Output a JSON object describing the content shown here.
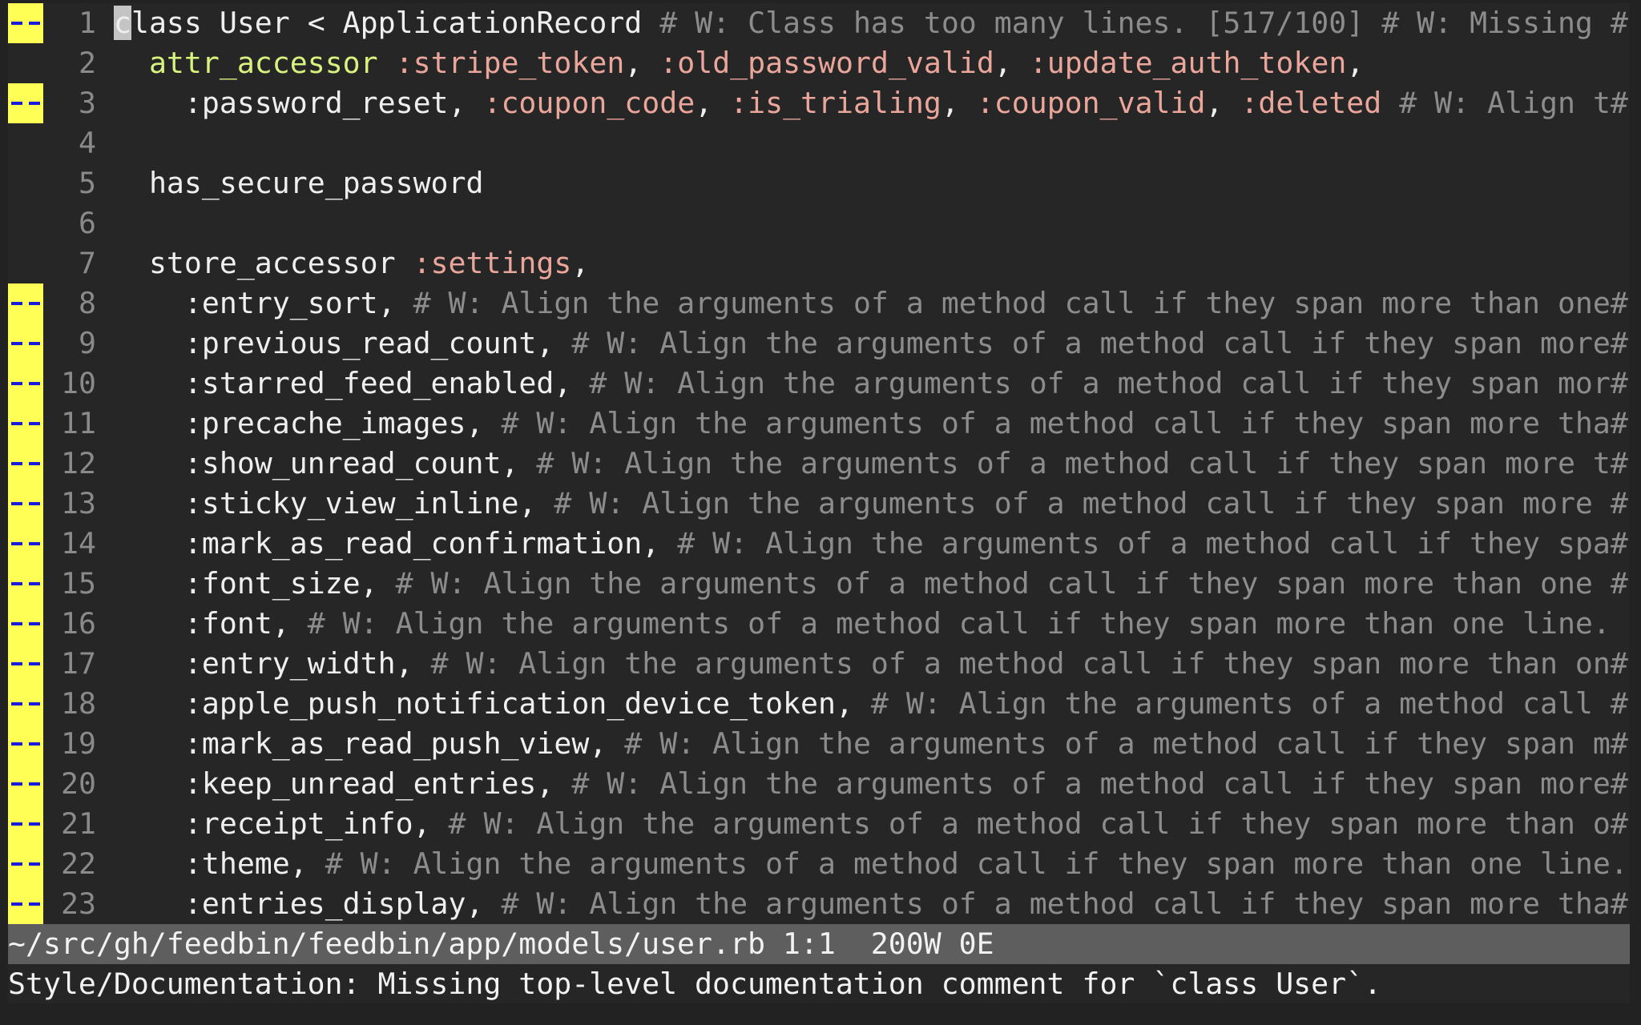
{
  "editor": {
    "lines": [
      {
        "num": "1",
        "sign": true,
        "cursor_char": "c",
        "segments": [
          {
            "t": "lass User < ApplicationRecord ",
            "c": "default"
          },
          {
            "t": "# W: Class has too many lines. [517/100] # W: Missing #",
            "c": "comment"
          }
        ]
      },
      {
        "num": "2",
        "sign": false,
        "segments": [
          {
            "t": "  ",
            "c": "default"
          },
          {
            "t": "attr_accessor",
            "c": "method"
          },
          {
            "t": " ",
            "c": "default"
          },
          {
            "t": ":stripe_token",
            "c": "symbol"
          },
          {
            "t": ", ",
            "c": "default"
          },
          {
            "t": ":old_password_valid",
            "c": "symbol"
          },
          {
            "t": ", ",
            "c": "default"
          },
          {
            "t": ":update_auth_token",
            "c": "symbol"
          },
          {
            "t": ",",
            "c": "default"
          }
        ]
      },
      {
        "num": "3",
        "sign": true,
        "segments": [
          {
            "t": "    :password_reset, ",
            "c": "default"
          },
          {
            "t": ":coupon_code",
            "c": "symbol"
          },
          {
            "t": ", ",
            "c": "default"
          },
          {
            "t": ":is_trialing",
            "c": "symbol"
          },
          {
            "t": ", ",
            "c": "default"
          },
          {
            "t": ":coupon_valid",
            "c": "symbol"
          },
          {
            "t": ", ",
            "c": "default"
          },
          {
            "t": ":deleted",
            "c": "symbol"
          },
          {
            "t": " # W: Align t#",
            "c": "comment"
          }
        ]
      },
      {
        "num": "4",
        "sign": false,
        "segments": []
      },
      {
        "num": "5",
        "sign": false,
        "segments": [
          {
            "t": "  has_secure_password",
            "c": "default"
          }
        ]
      },
      {
        "num": "6",
        "sign": false,
        "segments": []
      },
      {
        "num": "7",
        "sign": false,
        "segments": [
          {
            "t": "  store_accessor ",
            "c": "default"
          },
          {
            "t": ":settings",
            "c": "symbol"
          },
          {
            "t": ",",
            "c": "default"
          }
        ]
      },
      {
        "num": "8",
        "sign": true,
        "segments": [
          {
            "t": "    :entry_sort, ",
            "c": "default"
          },
          {
            "t": "# W: Align the arguments of a method call if they span more than one#",
            "c": "comment"
          }
        ]
      },
      {
        "num": "9",
        "sign": true,
        "segments": [
          {
            "t": "    :previous_read_count, ",
            "c": "default"
          },
          {
            "t": "# W: Align the arguments of a method call if they span more#",
            "c": "comment"
          }
        ]
      },
      {
        "num": "10",
        "sign": true,
        "segments": [
          {
            "t": "    :starred_feed_enabled, ",
            "c": "default"
          },
          {
            "t": "# W: Align the arguments of a method call if they span mor#",
            "c": "comment"
          }
        ]
      },
      {
        "num": "11",
        "sign": true,
        "segments": [
          {
            "t": "    :precache_images, ",
            "c": "default"
          },
          {
            "t": "# W: Align the arguments of a method call if they span more tha#",
            "c": "comment"
          }
        ]
      },
      {
        "num": "12",
        "sign": true,
        "segments": [
          {
            "t": "    :show_unread_count, ",
            "c": "default"
          },
          {
            "t": "# W: Align the arguments of a method call if they span more t#",
            "c": "comment"
          }
        ]
      },
      {
        "num": "13",
        "sign": true,
        "segments": [
          {
            "t": "    :sticky_view_inline, ",
            "c": "default"
          },
          {
            "t": "# W: Align the arguments of a method call if they span more #",
            "c": "comment"
          }
        ]
      },
      {
        "num": "14",
        "sign": true,
        "segments": [
          {
            "t": "    :mark_as_read_confirmation, ",
            "c": "default"
          },
          {
            "t": "# W: Align the arguments of a method call if they spa#",
            "c": "comment"
          }
        ]
      },
      {
        "num": "15",
        "sign": true,
        "segments": [
          {
            "t": "    :font_size, ",
            "c": "default"
          },
          {
            "t": "# W: Align the arguments of a method call if they span more than one #",
            "c": "comment"
          }
        ]
      },
      {
        "num": "16",
        "sign": true,
        "segments": [
          {
            "t": "    :font, ",
            "c": "default"
          },
          {
            "t": "# W: Align the arguments of a method call if they span more than one line.",
            "c": "comment"
          }
        ]
      },
      {
        "num": "17",
        "sign": true,
        "segments": [
          {
            "t": "    :entry_width, ",
            "c": "default"
          },
          {
            "t": "# W: Align the arguments of a method call if they span more than on#",
            "c": "comment"
          }
        ]
      },
      {
        "num": "18",
        "sign": true,
        "segments": [
          {
            "t": "    :apple_push_notification_device_token, ",
            "c": "default"
          },
          {
            "t": "# W: Align the arguments of a method call #",
            "c": "comment"
          }
        ]
      },
      {
        "num": "19",
        "sign": true,
        "segments": [
          {
            "t": "    :mark_as_read_push_view, ",
            "c": "default"
          },
          {
            "t": "# W: Align the arguments of a method call if they span m#",
            "c": "comment"
          }
        ]
      },
      {
        "num": "20",
        "sign": true,
        "segments": [
          {
            "t": "    :keep_unread_entries, ",
            "c": "default"
          },
          {
            "t": "# W: Align the arguments of a method call if they span more#",
            "c": "comment"
          }
        ]
      },
      {
        "num": "21",
        "sign": true,
        "segments": [
          {
            "t": "    :receipt_info, ",
            "c": "default"
          },
          {
            "t": "# W: Align the arguments of a method call if they span more than o#",
            "c": "comment"
          }
        ]
      },
      {
        "num": "22",
        "sign": true,
        "segments": [
          {
            "t": "    :theme, ",
            "c": "default"
          },
          {
            "t": "# W: Align the arguments of a method call if they span more than one line.",
            "c": "comment"
          }
        ]
      },
      {
        "num": "23",
        "sign": true,
        "segments": [
          {
            "t": "    :entries_display, ",
            "c": "default"
          },
          {
            "t": "# W: Align the arguments of a method call if they span more tha#",
            "c": "comment"
          }
        ]
      }
    ],
    "sign_marker": "--"
  },
  "statusline": {
    "text": "~/src/gh/feedbin/feedbin/app/models/user.rb 1:1  200W 0E"
  },
  "message": {
    "text": "Style/Documentation: Missing top-level documentation comment for `class User`."
  },
  "colors": {
    "background": "#262626",
    "sign_column": "#ffff55",
    "sign_dash": "#1a1adb",
    "method": "#d7f27e",
    "symbol": "#eba69b",
    "comment": "#8c8c8c",
    "line_number": "#8a8a8a",
    "statusline_bg": "#5e5e5e"
  }
}
